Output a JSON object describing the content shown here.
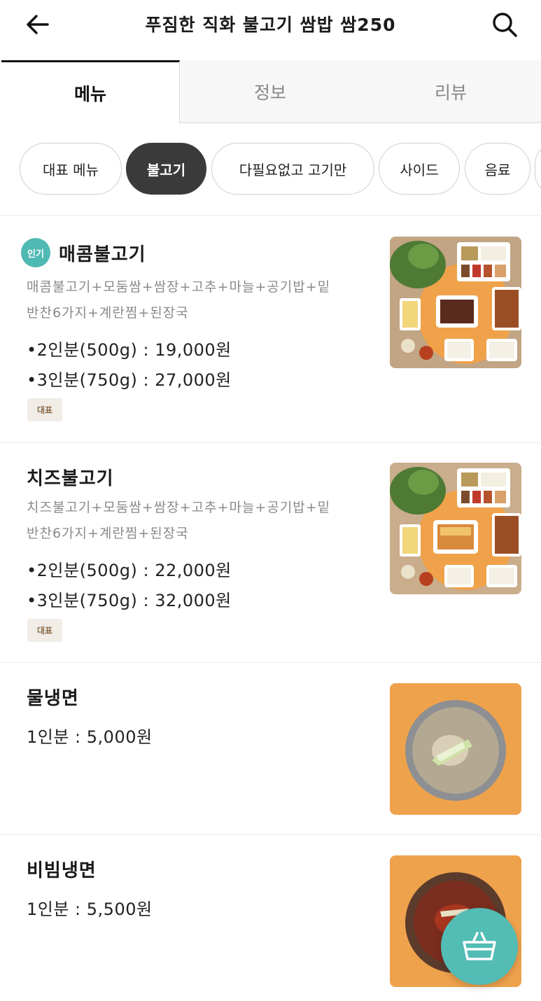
{
  "header": {
    "title": "푸짐한 직화 불고기 쌈밥 쌈250",
    "back_icon": "arrow-left-icon",
    "search_icon": "search-icon"
  },
  "tabs": [
    {
      "label": "메뉴",
      "active": true
    },
    {
      "label": "정보",
      "active": false
    },
    {
      "label": "리뷰",
      "active": false
    }
  ],
  "categories": [
    {
      "label": "대표 메뉴",
      "active": false
    },
    {
      "label": "불고기",
      "active": true
    },
    {
      "label": "다필요없고 고기만",
      "active": false
    },
    {
      "label": "사이드",
      "active": false
    },
    {
      "label": "음료",
      "active": false
    }
  ],
  "menu": [
    {
      "badge": "인기",
      "name": "매콤불고기",
      "desc_line1": "매콤불고기+모둠쌈+쌈장+고추+마늘+공기밥+밑",
      "desc_line2": "반찬6가지+계란찜+된장국",
      "price1": "•2인분(500g) : 19,000원",
      "price2": "•3인분(750g) : 27,000원",
      "tag": "대표"
    },
    {
      "name": "치즈불고기",
      "desc_line1": "치즈불고기+모둠쌈+쌈장+고추+마늘+공기밥+밑",
      "desc_line2": "반찬6가지+계란찜+된장국",
      "price1": "•2인분(500g) : 22,000원",
      "price2": "•3인분(750g) : 32,000원",
      "tag": "대표"
    },
    {
      "name": "물냉면",
      "price1": "1인분 : 5,000원"
    },
    {
      "name": "비빔냉면",
      "price1": "1인분 : 5,500원"
    }
  ],
  "cart_icon": "basket-icon",
  "colors": {
    "accent_teal": "#52bcb5",
    "chip_active": "#3a3a3a",
    "tag_bg": "#f1ece6",
    "tray_orange": "#f0a24a"
  }
}
